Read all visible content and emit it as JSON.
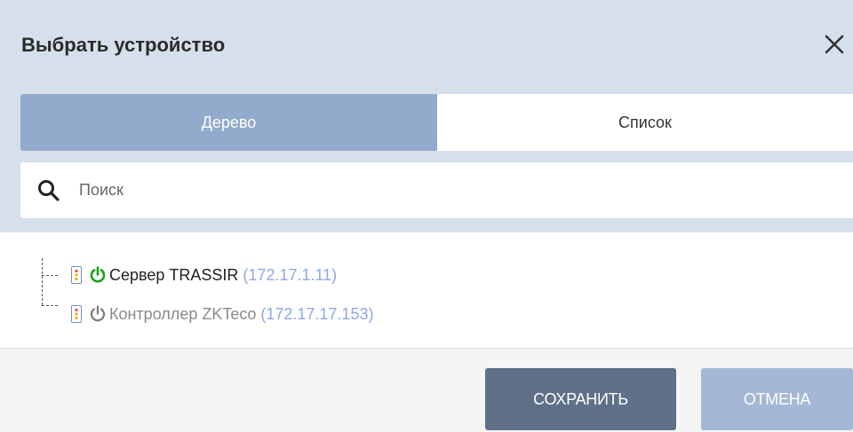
{
  "dialog": {
    "title": "Выбрать устройство"
  },
  "tabs": [
    {
      "label": "Дерево",
      "active": true
    },
    {
      "label": "Список",
      "active": false
    }
  ],
  "search": {
    "placeholder": "Поиск",
    "value": ""
  },
  "tree": [
    {
      "name": "Сервер TRASSIR",
      "ip": "(172.17.1.11)",
      "status": "online",
      "status_color": "#1aa31a"
    },
    {
      "name": "Контроллер ZKTeco",
      "ip": "(172.17.17.153)",
      "status": "offline",
      "status_color": "#7a7a7a"
    }
  ],
  "footer": {
    "save_label": "СОХРАНИТЬ",
    "cancel_label": "ОТМЕНА"
  },
  "colors": {
    "header_bg": "#d6e0ec",
    "tab_active": "#92aacb",
    "save_btn": "#5f7088",
    "cancel_btn": "#a4b8d6",
    "ip_text": "#8fa8e4"
  }
}
